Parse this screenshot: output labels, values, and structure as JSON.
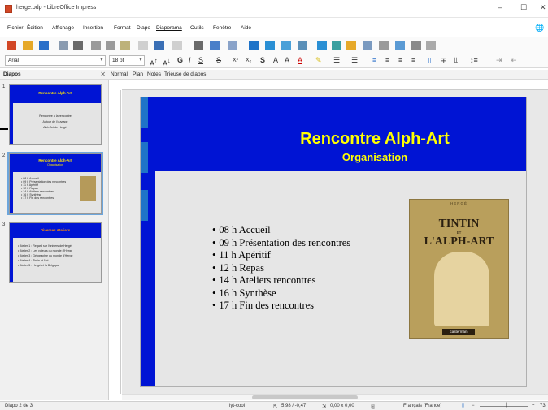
{
  "window": {
    "title": "herge.odp - LibreOffice Impress",
    "controls": [
      "–",
      "☐",
      "✕"
    ]
  },
  "menu": [
    "Fichier",
    "Édition",
    "Affichage",
    "Insertion",
    "Format",
    "Diapo",
    "Diaporama",
    "Outils",
    "Fenêtre",
    "Aide"
  ],
  "menu_active": "Diaporama",
  "formatting": {
    "font_name": "Arial",
    "font_size": "18 pt"
  },
  "slides_panel": {
    "title": "Diapos",
    "close": "✕"
  },
  "tabs": [
    "Normal",
    "Plan",
    "Notes",
    "Trieuse de diapos"
  ],
  "thumbnails": [
    {
      "number": "1",
      "title": "Rencontre Alph-Art",
      "subtitle": "",
      "lines": [
        "Rencontre à la rencontre",
        "Autour de l'ouvrage",
        "Alph-Art de Hergé."
      ]
    },
    {
      "number": "2",
      "title": "Rencontre Alph-Art",
      "subtitle": "Organisation",
      "lines": [
        "• 08 h Accueil",
        "• 09 h Présentation des rencontres",
        "• 11 h Apéritif",
        "• 12 h Repas",
        "• 14 h Ateliers rencontres",
        "• 16 h Synthèse",
        "• 17 h Fin des rencontres"
      ]
    },
    {
      "number": "3",
      "title": "Diverses Ateliers",
      "subtitle": "",
      "lines": [
        "• Atelier 1 : Regard sur l'univers de Hergé",
        "• Atelier 2 : Les voleurs du monde d'Hergé",
        "• Atelier 3 : Géographie du monde d'Hergé",
        "• Atelier 4 : Tintin et l'art",
        "• Atelier 5 : Hergé et la Belgique"
      ]
    }
  ],
  "slide": {
    "title": "Rencontre Alph-Art",
    "subtitle": "Organisation",
    "bullets": [
      "08 h  Accueil",
      "09 h Présentation des rencontres",
      "11 h Apéritif",
      "12 h Repas",
      "14 h Ateliers rencontres",
      "16 h Synthèse",
      "17 h Fin des rencontres"
    ],
    "book_cover": {
      "author": "HERGÉ",
      "title_line1": "TINTIN",
      "title_et": "ET",
      "title_line2": "L'ALPH-ART",
      "publisher": "casterman"
    }
  },
  "status": {
    "slide_info": "Diapo 2 de 3",
    "layout": "lyt-cool",
    "position": "5,98 / -0,47",
    "size": "0,00 x 0,00",
    "language": "Français (France)",
    "zoom": "73"
  },
  "colors": {
    "slide_blue": "#0014d4",
    "slide_title": "#ffff00",
    "selection": "#6da6dc"
  }
}
